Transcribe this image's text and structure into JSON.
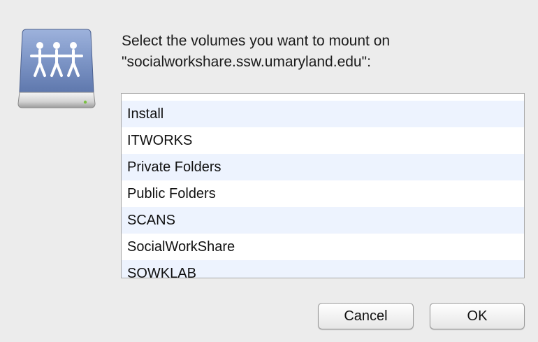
{
  "dialog": {
    "prompt_line1": "Select the volumes you want to mount on",
    "prompt_line2": "\"socialworkshare.ssw.umaryland.edu\":",
    "icon": "network-server-drive-icon"
  },
  "volumes": [
    "Install",
    "ITWORKS",
    "Private Folders",
    "Public Folders",
    "SCANS",
    "SocialWorkShare",
    "SOWKLAB"
  ],
  "buttons": {
    "cancel_label": "Cancel",
    "ok_label": "OK"
  },
  "colors": {
    "window_bg": "#ececec",
    "list_alt_row": "#edf3fe",
    "drive_body": "#7d95c6"
  }
}
